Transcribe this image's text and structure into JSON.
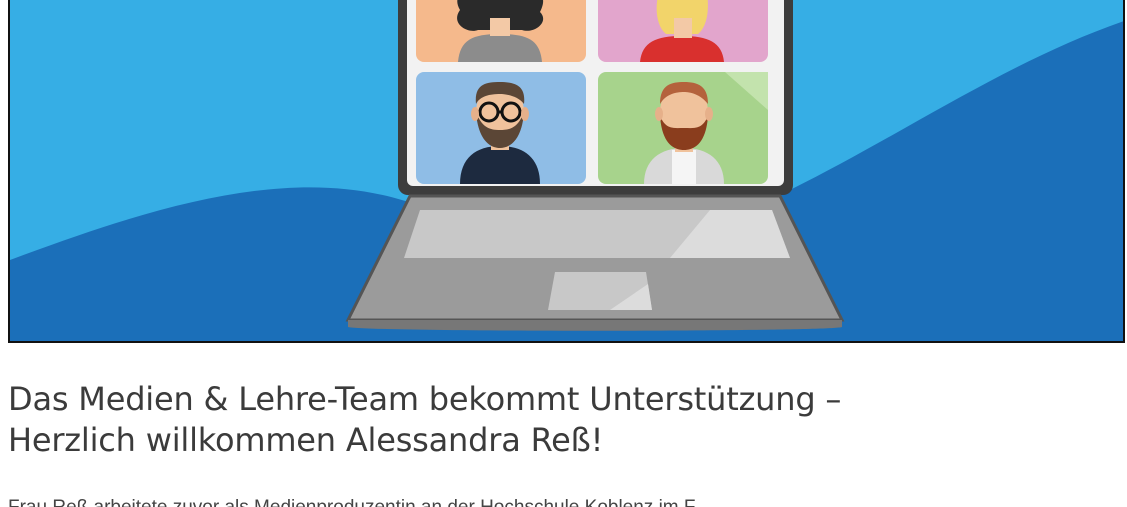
{
  "article": {
    "image_alt": "Illustration: Laptop mit Videokonferenz",
    "headline_line1": "Das Medien & Lehre-Team bekommt Unterstützung –",
    "headline_line2": "Herzlich willkommen Alessandra Reß!",
    "body_preview": "Frau Reß arbeitete zuvor als Medienproduzentin an der Hochschule Koblenz im F"
  },
  "colors": {
    "hero_light_blue": "#36aee5",
    "hero_dark_blue": "#1b6fb9",
    "headline": "#3b3b3b",
    "body": "#444444"
  }
}
